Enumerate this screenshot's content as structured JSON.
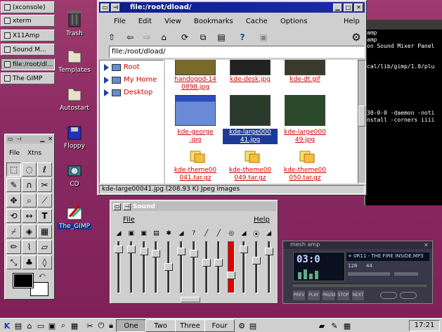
{
  "tasks": [
    "(xconsole)",
    "xterm",
    "X11Amp",
    "Sound M...",
    "file:/root/dl...",
    "The GIMP"
  ],
  "desktop_icons": [
    "Trash",
    "Templates",
    "Autostart",
    "Floppy",
    "CD",
    "The_GIMP"
  ],
  "terminal_lines": [
    "amp",
    "amp",
    "on Sound Mixer Panel",
    "",
    "",
    "cal/lib/gimp/1.0/plu",
    "",
    "",
    "",
    "",
    "",
    "",
    "30-0-0 -daemon -noti",
    "nstall -corners iiii",
    "",
    "",
    "",
    "",
    "",
    "",
    "",
    "",
    "",
    "",
    "",
    "",
    ""
  ],
  "kfm": {
    "title": "file:/root/dload/",
    "menu": [
      "File",
      "Edit",
      "View",
      "Bookmarks",
      "Cache",
      "Options",
      "Help"
    ],
    "location": "file:/root/dload/",
    "tree": [
      "Root",
      "My Home",
      "Desktop"
    ],
    "files_top": [
      "handogod-14\n0898.jpg",
      "kde-desk.jpg",
      "kde-dt.gif"
    ],
    "files_mid": [
      "kde-george\n.jpg",
      "kde-large000\n41.jpg",
      "kde-large000\n49.jpg"
    ],
    "files_bot": [
      "kde-theme00\n041.tar.gz",
      "kde-theme00\n049.tar.gz",
      "kde-theme00\n050.tar.gz"
    ],
    "status": "kde-large00041.jpg (208.93 K)  Jpeg images"
  },
  "gimp": {
    "menu": [
      "File",
      "Xtns"
    ]
  },
  "mixer": {
    "title": "Sound",
    "menu_file": "File",
    "menu_help": "Help",
    "levels": [
      0.9,
      0.9,
      0.85,
      0.8,
      0.5,
      0.85,
      0.8,
      0.6,
      0.6,
      0.3,
      0.9,
      0.65,
      0.85
    ]
  },
  "player": {
    "title": "mesh amp",
    "time": "03:0",
    "track": "+ 0R11 - THE FIRE INSIDE.MP3",
    "kbps": "128",
    "khz": "44",
    "buttons": [
      "PREV",
      "PLAY",
      "PAUSE",
      "STOP",
      "NEXT"
    ]
  },
  "panel": {
    "desktops": [
      "One",
      "Two",
      "Three",
      "Four"
    ],
    "clock": "17:21"
  },
  "colors": {
    "titlebar": "#0d1c8c",
    "link": "#cc0000",
    "desktop": "#8a2a62"
  }
}
